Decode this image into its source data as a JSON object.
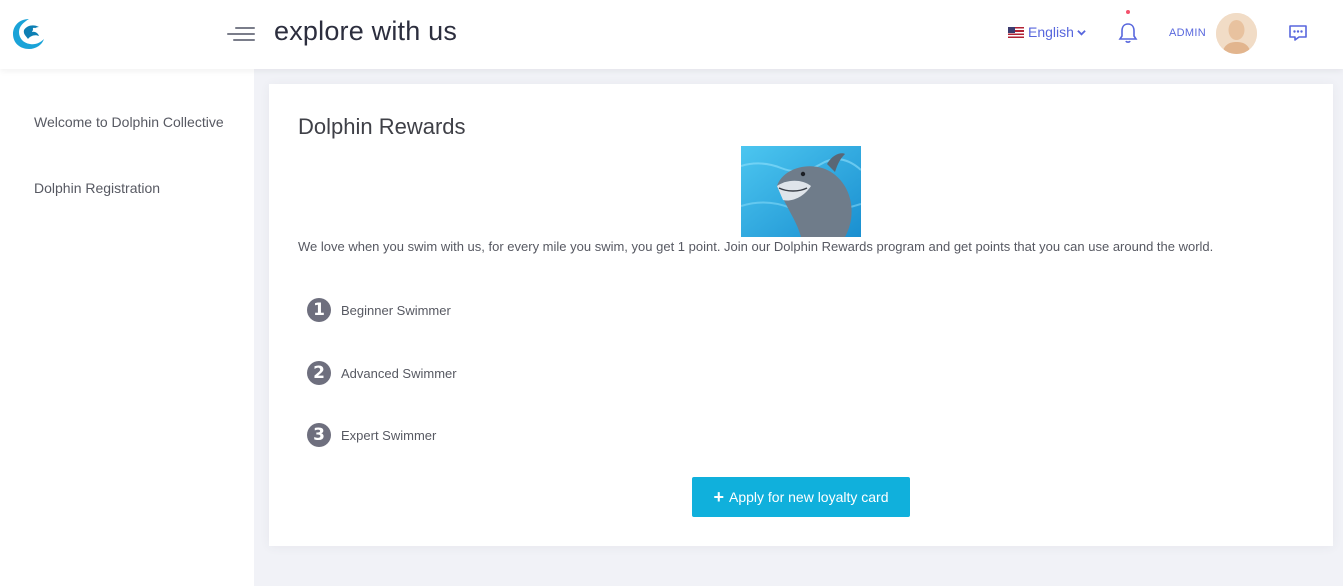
{
  "header": {
    "title": "explore with us",
    "language": "English",
    "user": "ADMIN"
  },
  "icons": {
    "logo": "dolphin-logo-icon",
    "menu": "hamburger-icon",
    "flag": "us-flag-icon",
    "language_dropdown": "chevron-down-icon",
    "notifications": "bell-icon",
    "chat": "chat-icon",
    "apply": "plus-icon"
  },
  "sidebar": {
    "items": [
      {
        "label": "Welcome to Dolphin Collective"
      },
      {
        "label": "Dolphin Registration"
      }
    ]
  },
  "main": {
    "title": "Dolphin Rewards",
    "image": "dolphin-photo",
    "intro": "We love when you swim with us, for every mile you swim, you get 1 point. Join our Dolphin Rewards program and get points that you can use around the world.",
    "tiers": [
      {
        "number": "1",
        "label": "Beginner Swimmer"
      },
      {
        "number": "2",
        "label": "Advanced Swimmer"
      },
      {
        "number": "3",
        "label": "Expert Swimmer"
      }
    ],
    "apply_button": "Apply for new loyalty card"
  },
  "colors": {
    "accent": "#5867dd",
    "button": "#10b0dc",
    "notification_dot": "#f4516c",
    "background": "#f1f2f7"
  }
}
